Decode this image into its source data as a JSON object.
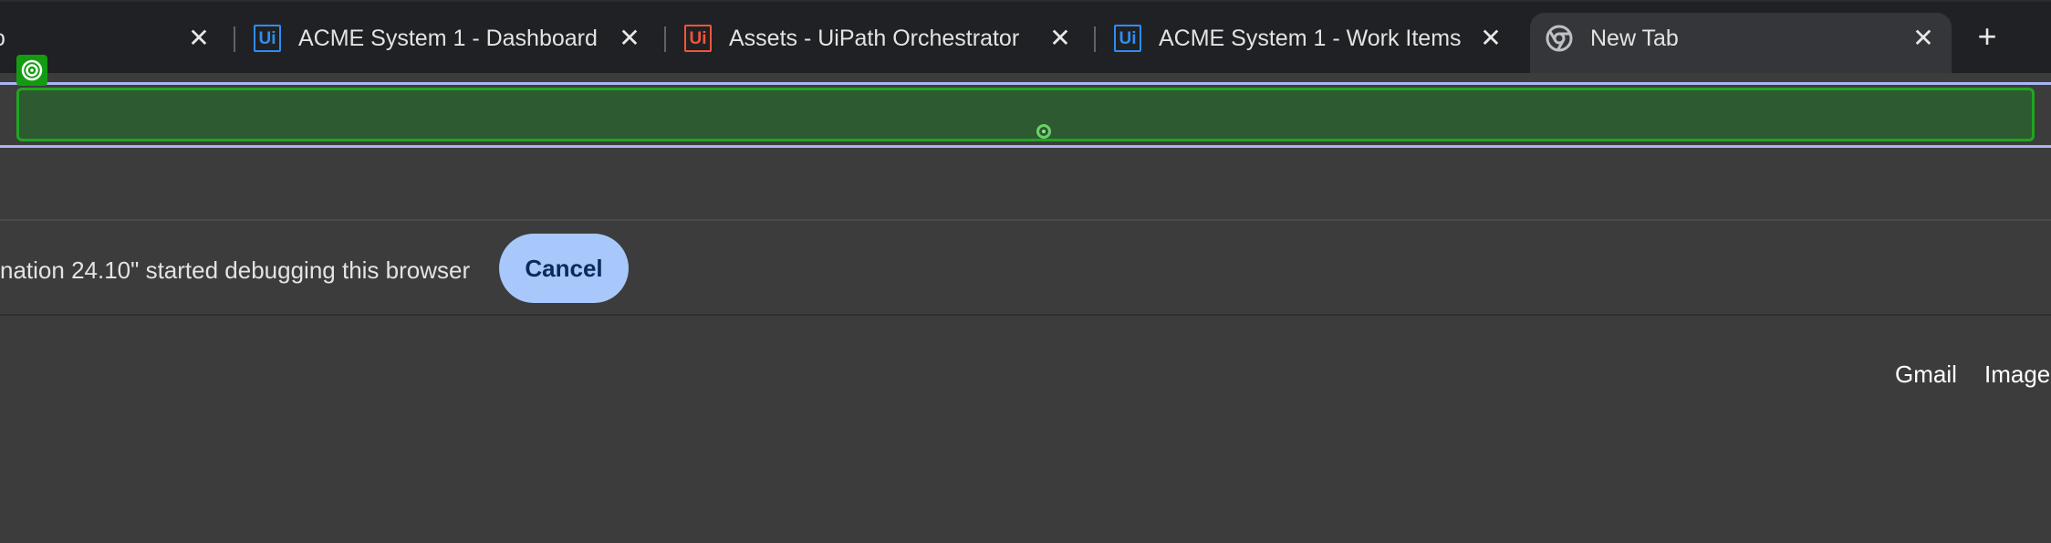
{
  "tabs": [
    {
      "title": "o",
      "close": "✕"
    },
    {
      "title": "ACME System 1 - Dashboard",
      "favicon": "Ui",
      "close": "✕"
    },
    {
      "title": "Assets - UiPath Orchestrator",
      "favicon": "Ui",
      "close": "✕"
    },
    {
      "title": "ACME System 1 - Work Items",
      "favicon": "Ui",
      "close": "✕"
    },
    {
      "title": "New Tab",
      "close": "✕",
      "active": true
    }
  ],
  "newtab": {
    "label": "+"
  },
  "infobar": {
    "message": "nation 24.10\" started debugging this browser",
    "cancel_label": "Cancel"
  },
  "links": {
    "gmail": "Gmail",
    "images": "Image"
  },
  "colors": {
    "highlight_fill": "#2e5a31",
    "highlight_border": "#1fa620",
    "badge": "#139c12",
    "cancel_bg": "#a8c7fa",
    "uipath_blue": "#2f8ef0",
    "uipath_red": "#f0563a"
  },
  "icons": {
    "tab0": "partial-tab",
    "tab1": "uipath-blue-icon",
    "tab2": "uipath-red-icon",
    "tab3": "uipath-blue-icon",
    "tab4": "chrome-icon",
    "badge": "target-icon"
  }
}
